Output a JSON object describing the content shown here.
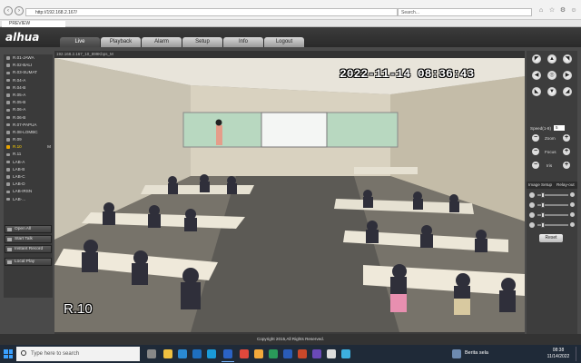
{
  "browser": {
    "url": "http://192.168.2.167/",
    "search_placeholder": "Search...",
    "tab_label": "PREVIEW"
  },
  "app": {
    "logo": "alhua",
    "menu": [
      {
        "label": "Live",
        "active": true
      },
      {
        "label": "Playback",
        "active": false
      },
      {
        "label": "Alarm",
        "active": false
      },
      {
        "label": "Setup",
        "active": false
      },
      {
        "label": "Info",
        "active": false
      },
      {
        "label": "Logout",
        "active": false
      }
    ],
    "footer": "Copyright 2015,All Rights Reserved."
  },
  "channels": [
    "R.01-JAWA",
    "R.02-BALI",
    "R.03-SUMAT",
    "R.04-A",
    "R.04-B",
    "R.05-A",
    "R.05-B",
    "R.06-A",
    "R.06-B",
    "R.07-PAPUA",
    "R.08-LOMBC",
    "R.09",
    "R.10",
    "R.11",
    "LAB-A",
    "LAB-B",
    "LAB-C",
    "LAB-D",
    "LAB-IRSN",
    "LAB-..."
  ],
  "active_channel": "R.10",
  "active_channel_badge": "M",
  "side_buttons": [
    "Open All",
    "Start Talk",
    "Instant Record",
    "Local Play"
  ],
  "video": {
    "title": "192.168.2.167_10_899Kbps_M",
    "timestamp": "2022-11-14  08:36:43",
    "camera_name": "R.10"
  },
  "ptz": {
    "speed_label": "Speed(1-8)",
    "speed_value": "5",
    "zoom_label": "Zoom",
    "focus_label": "Focus",
    "iris_label": "Iris",
    "image_setup_label": "Image Setup",
    "relay_label": "Relay-out",
    "reset_label": "Reset"
  },
  "taskbar": {
    "search_placeholder": "Type here to search",
    "weather_text": "Berita sela",
    "time": "08:38",
    "date": "11/14/2022"
  },
  "colors": {
    "active_channel": "#ffd200",
    "taskbar": "#1f2a38",
    "whiteboard": "#b8d8c0"
  }
}
